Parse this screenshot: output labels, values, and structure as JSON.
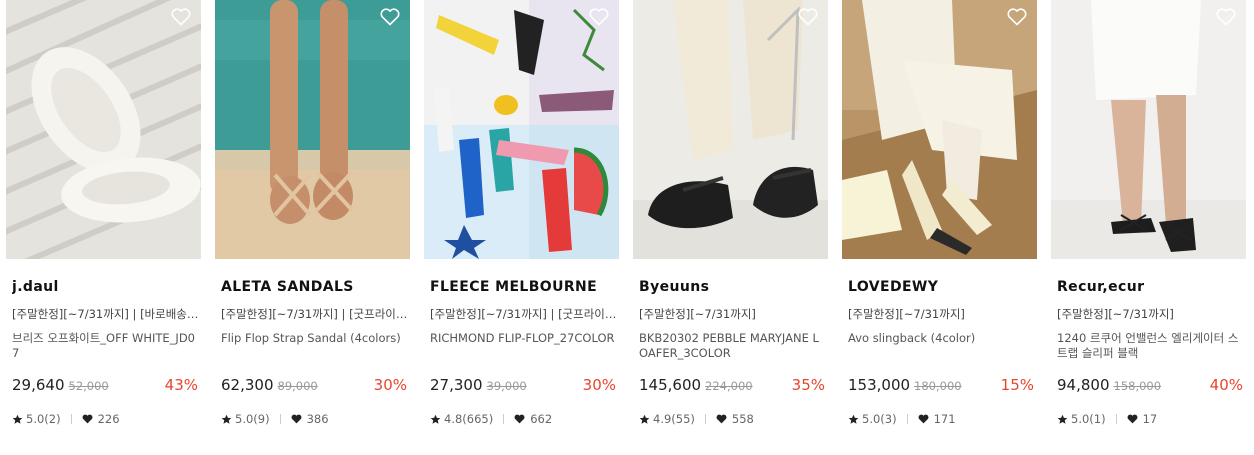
{
  "products": [
    {
      "brand": "j.daul",
      "tags": "[주말한정][~7/31까지] | [바로배송…",
      "name": "브리즈 오프화이트_OFF WHITE_JD07",
      "price": "29,640",
      "original_price": "52,000",
      "discount": "43%",
      "rating": "5.0(2)",
      "likes": "226"
    },
    {
      "brand": "ALETA SANDALS",
      "tags": "[주말한정][~7/31까지] | [굿프라이…",
      "name": "Flip Flop Strap Sandal (4colors)",
      "price": "62,300",
      "original_price": "89,000",
      "discount": "30%",
      "rating": "5.0(9)",
      "likes": "386"
    },
    {
      "brand": "FLEECE MELBOURNE",
      "tags": "[주말한정][~7/31까지] | [굿프라이…",
      "name": "RICHMOND FLIP-FLOP_27COLOR",
      "price": "27,300",
      "original_price": "39,000",
      "discount": "30%",
      "rating": "4.8(665)",
      "likes": "662"
    },
    {
      "brand": "Byeuuns",
      "tags": "[주말한정][~7/31까지]",
      "name": "BKB20302 PEBBLE MARYJANE LOAFER_3COLOR",
      "price": "145,600",
      "original_price": "224,000",
      "discount": "35%",
      "rating": "4.9(55)",
      "likes": "558"
    },
    {
      "brand": "LOVEDEWY",
      "tags": "[주말한정][~7/31까지]",
      "name": "Avo slingback (4color)",
      "price": "153,000",
      "original_price": "180,000",
      "discount": "15%",
      "rating": "5.0(3)",
      "likes": "171"
    },
    {
      "brand": "Recur,ecur",
      "tags": "[주말한정][~7/31까지]",
      "name": "1240 르쿠어 언밸런스 엘리게이터 스트랩 슬리퍼 블랙",
      "price": "94,800",
      "original_price": "158,000",
      "discount": "40%",
      "rating": "5.0(1)",
      "likes": "17"
    }
  ],
  "icons": {
    "wishlist": "heart-outline-icon",
    "rating": "star-icon",
    "likes": "heart-filled-icon"
  },
  "colors": {
    "discount": "#e8452f",
    "text": "#222222",
    "muted": "#999999"
  }
}
